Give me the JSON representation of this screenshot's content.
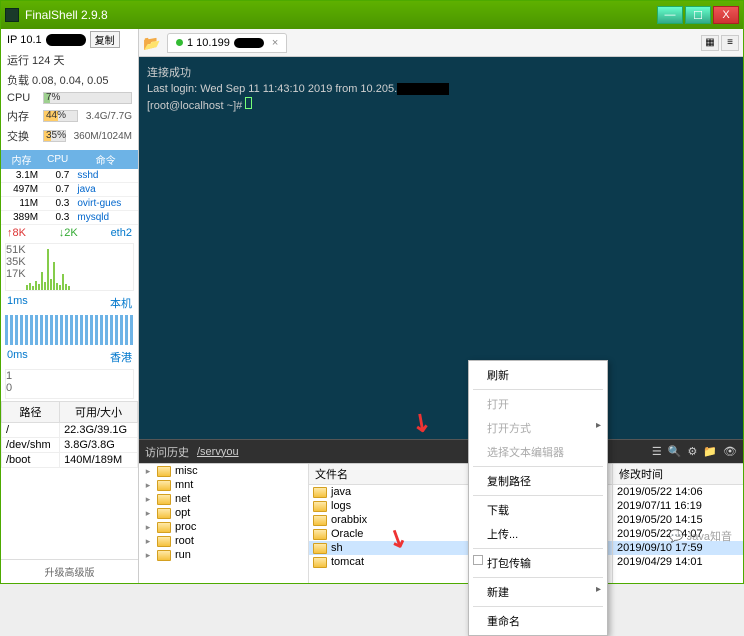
{
  "titlebar": {
    "title": "FinalShell 2.9.8"
  },
  "winbtns": {
    "min": "—",
    "max": "☐",
    "close": "X"
  },
  "sidebar": {
    "ip": "IP 10.1",
    "copy": "复制",
    "uptime": "运行 124 天",
    "load": "负载 0.08, 0.04, 0.05",
    "cpu": {
      "label": "CPU",
      "pct": "7%",
      "width": 7
    },
    "mem": {
      "label": "内存",
      "pct": "44%",
      "right": "3.4G/7.7G",
      "width": 44
    },
    "swap": {
      "label": "交换",
      "pct": "35%",
      "right": "360M/1024M",
      "width": 35
    },
    "proc_headers": [
      "内存",
      "CPU",
      "命令"
    ],
    "procs": [
      {
        "mem": "3.1M",
        "cpu": "0.7",
        "cmd": "sshd"
      },
      {
        "mem": "497M",
        "cpu": "0.7",
        "cmd": "java"
      },
      {
        "mem": "11M",
        "cpu": "0.3",
        "cmd": "ovirt-gues"
      },
      {
        "mem": "389M",
        "cpu": "0.3",
        "cmd": "mysqld"
      }
    ],
    "net": {
      "up": "8K",
      "down": "2K",
      "iface": "eth2",
      "ticks": [
        "51K",
        "35K",
        "17K"
      ]
    },
    "ping": {
      "label": "1ms",
      "right": "本机",
      "ticks": [
        "1",
        "0.5",
        "0"
      ]
    },
    "ping2": {
      "label": "0ms",
      "right": "香港",
      "ticks": [
        "1",
        "0"
      ]
    },
    "disk_headers": [
      "路径",
      "可用/大小"
    ],
    "disks": [
      {
        "path": "/",
        "size": "22.3G/39.1G"
      },
      {
        "path": "/dev/shm",
        "size": "3.8G/3.8G"
      },
      {
        "path": "/boot",
        "size": "140M/189M"
      }
    ],
    "upgrade": "升级高级版"
  },
  "tabs": {
    "active": "1 10.199",
    "close": "×"
  },
  "terminal": {
    "line1": "连接成功",
    "line2a": "Last login: Wed Sep 11 11:43:10 2019 from 10.205.",
    "line3": "[root@localhost ~]# "
  },
  "fm_toolbar": {
    "label": "访问历史",
    "path": "/servyou"
  },
  "fm_left": {
    "items": [
      "misc",
      "mnt",
      "net",
      "opt",
      "proc",
      "root",
      "run"
    ]
  },
  "fm_mid": {
    "header": "文件名",
    "items": [
      "java",
      "logs",
      "orabbix",
      "Oracle",
      "sh",
      "tomcat"
    ]
  },
  "fm_right": {
    "header": "修改时间",
    "items": [
      "2019/05/22 14:06",
      "2019/07/11 16:19",
      "2019/05/20 14:15",
      "2019/05/22 14:07",
      "2019/09/10 17:59",
      "2019/04/29 14:01"
    ]
  },
  "ctx": {
    "refresh": "刷新",
    "open": "打开",
    "open_with": "打开方式",
    "editor": "选择文本编辑器",
    "copy_path": "复制路径",
    "download": "下载",
    "upload": "上传...",
    "pack": "打包传输",
    "new": "新建",
    "rename": "重命名"
  },
  "watermark": "Java知音"
}
